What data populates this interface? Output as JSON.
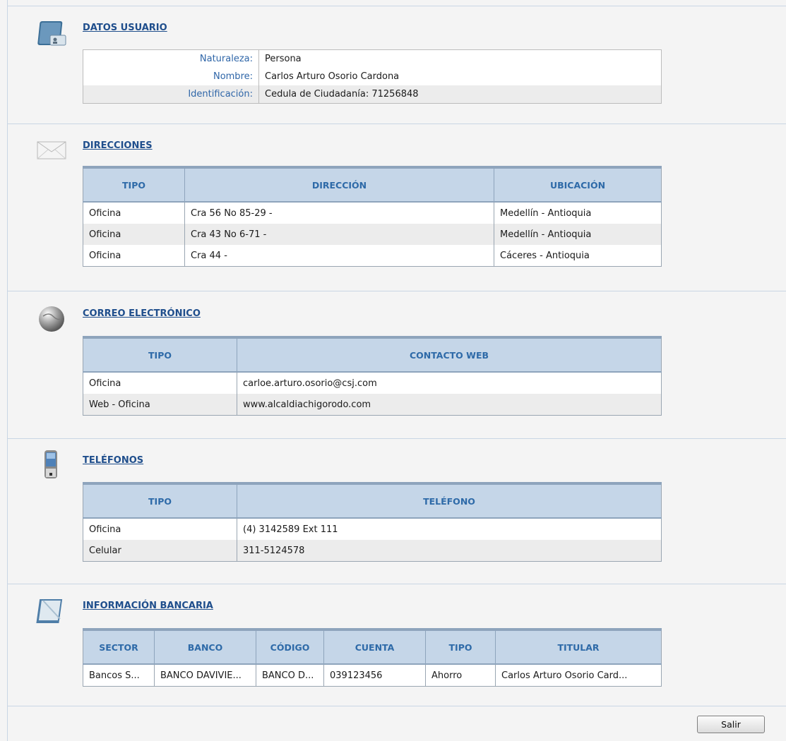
{
  "user": {
    "title": "DATOS USUARIO",
    "rows": [
      {
        "label": "Naturaleza:",
        "value": "Persona"
      },
      {
        "label": "Nombre:",
        "value": "Carlos Arturo Osorio Cardona"
      },
      {
        "label": "Identificación:",
        "value": "Cedula de Ciudadanía: 71256848"
      }
    ]
  },
  "addresses": {
    "title": "DIRECCIONES",
    "headers": [
      "TIPO",
      "DIRECCIÓN",
      "UBICACIÓN"
    ],
    "rows": [
      [
        "Oficina",
        "Cra 56 No 85-29 -",
        "Medellín - Antioquia"
      ],
      [
        "Oficina",
        "Cra 43 No 6-71 -",
        "Medellín - Antioquia"
      ],
      [
        "Oficina",
        "Cra 44 -",
        "Cáceres - Antioquia"
      ]
    ]
  },
  "email": {
    "title": "CORREO ELECTRÓNICO",
    "headers": [
      "TIPO",
      "CONTACTO WEB"
    ],
    "rows": [
      [
        "Oficina",
        "carloe.arturo.osorio@csj.com"
      ],
      [
        "Web - Oficina",
        "www.alcaldiachigorodo.com"
      ]
    ]
  },
  "phones": {
    "title": "TELÉFONOS",
    "headers": [
      "TIPO",
      "TELÉFONO"
    ],
    "rows": [
      [
        "Oficina",
        "(4) 3142589 Ext 111"
      ],
      [
        "Celular",
        "311-5124578"
      ]
    ]
  },
  "bank": {
    "title": "INFORMACIÓN BANCARIA",
    "headers": [
      "SECTOR",
      "BANCO",
      "CÓDIGO",
      "CUENTA",
      "TIPO",
      "TITULAR"
    ],
    "rows": [
      [
        "Bancos S...",
        "BANCO DAVIVIE...",
        "BANCO D...",
        "039123456",
        "Ahorro",
        "Carlos Arturo Osorio Card..."
      ]
    ]
  },
  "actions": {
    "exit_label": "Salir"
  },
  "icons": [
    "user-card-icon",
    "envelope-icon",
    "globe-icon",
    "mobile-phone-icon",
    "notebook-icon"
  ]
}
